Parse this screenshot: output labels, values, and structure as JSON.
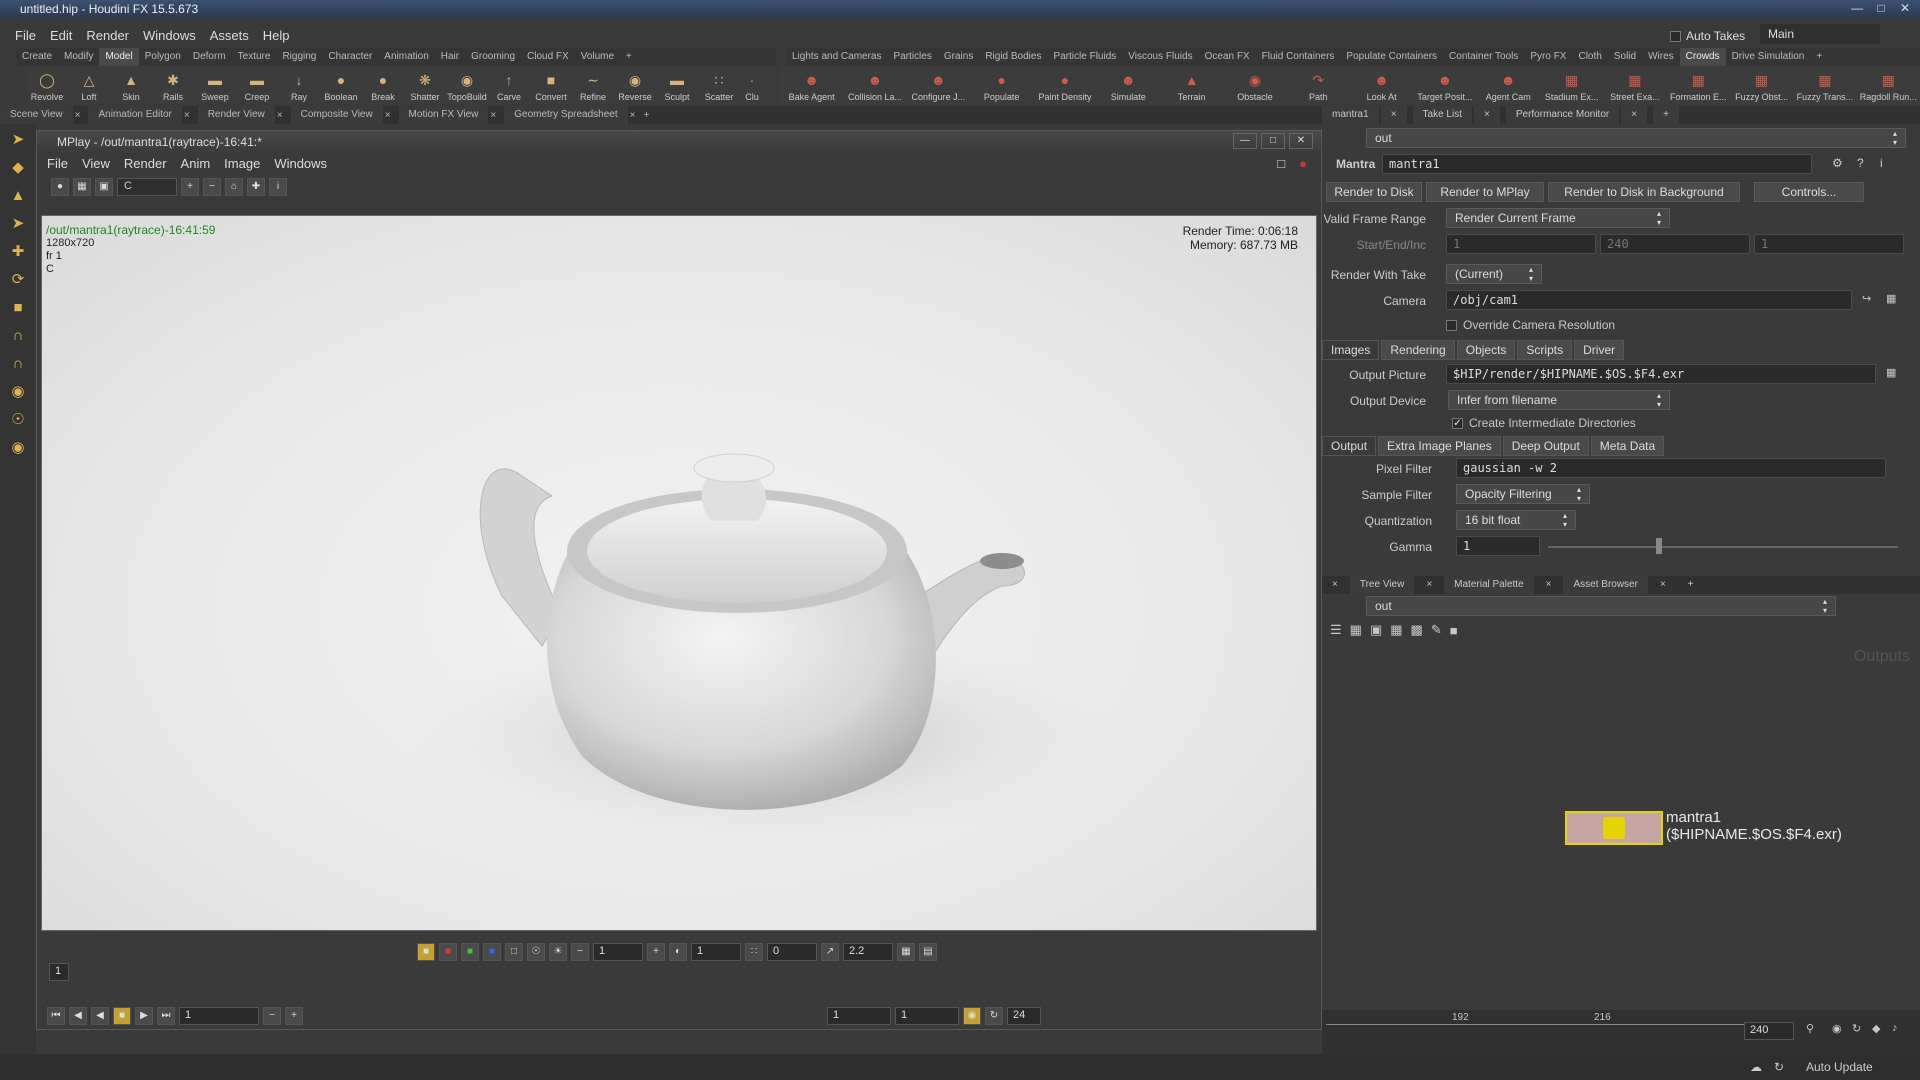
{
  "window": {
    "title": "untitled.hip - Houdini FX 15.5.673"
  },
  "menu": [
    "File",
    "Edit",
    "Render",
    "Windows",
    "Assets",
    "Help"
  ],
  "auto_takes": "Auto Takes",
  "desktop": "Main",
  "shelf_tabs_left": [
    "Create",
    "Modify",
    "Model",
    "Polygon",
    "Deform",
    "Texture",
    "Rigging",
    "Character",
    "Animation",
    "Hair",
    "Grooming",
    "Cloud FX",
    "Volume"
  ],
  "shelf_tabs_right": [
    "Lights and Cameras",
    "Particles",
    "Grains",
    "Rigid Bodies",
    "Particle Fluids",
    "Viscous Fluids",
    "Ocean FX",
    "Fluid Containers",
    "Populate Containers",
    "Container Tools",
    "Pyro FX",
    "Cloth",
    "Solid",
    "Wires",
    "Crowds",
    "Drive Simulation"
  ],
  "tools_left": [
    "Revolve",
    "Loft",
    "Skin",
    "Rails",
    "Sweep",
    "Creep",
    "Ray",
    "Boolean",
    "Break",
    "Shatter",
    "TopoBuild",
    "Carve",
    "Convert",
    "Refine",
    "Reverse",
    "Sculpt",
    "Scatter",
    "Clu"
  ],
  "tools_right": [
    "Bake Agent",
    "Collision La...",
    "Configure J...",
    "Populate",
    "Paint Density",
    "Simulate",
    "Terrain",
    "Obstacle",
    "Path",
    "Look At",
    "Target Posit...",
    "Agent Cam",
    "Stadium Ex...",
    "Street Exa...",
    "Formation E...",
    "Fuzzy Obst...",
    "Fuzzy Trans...",
    "Ragdoll Run..."
  ],
  "pane_tabs": [
    "Scene View",
    "Animation Editor",
    "Render View",
    "Composite View",
    "Motion FX View",
    "Geometry Spreadsheet"
  ],
  "mplay": {
    "title": "MPlay - /out/mantra1(raytrace)-16:41:*",
    "menu": [
      "File",
      "View",
      "Render",
      "Anim",
      "Image",
      "Windows"
    ],
    "channel": "C",
    "overlay": {
      "path": "/out/mantra1(raytrace)-16:41:59",
      "res": "1280x720",
      "frame": "fr 1",
      "channel": "C"
    },
    "render_time": "Render Time: 0:06:18",
    "memory": "Memory:   687.73 MB",
    "exposure": "1",
    "gamma_disp": "1",
    "offset": "0",
    "lut_gamma": "2.2",
    "frame_badge": "1",
    "frame_field": "1",
    "range_start": "1",
    "range_end": "1",
    "fps": "24"
  },
  "right_tabs": [
    "mantra1",
    "Take List",
    "Performance Monitor"
  ],
  "path_top": "out",
  "node_type": "Mantra",
  "node_name": "mantra1",
  "buttons": [
    "Render to Disk",
    "Render to MPlay",
    "Render to Disk in Background",
    "Controls..."
  ],
  "params": {
    "valid_frame_range": {
      "label": "Valid Frame Range",
      "value": "Render Current Frame"
    },
    "start_end_inc": {
      "label": "Start/End/Inc",
      "v1": "1",
      "v2": "240",
      "v3": "1"
    },
    "render_with_take": {
      "label": "Render With Take",
      "value": "(Current)"
    },
    "camera": {
      "label": "Camera",
      "value": "/obj/cam1"
    },
    "override": "Override Camera Resolution",
    "tabs1": [
      "Images",
      "Rendering",
      "Objects",
      "Scripts",
      "Driver"
    ],
    "output_picture": {
      "label": "Output Picture",
      "value": "$HIP/render/$HIPNAME.$OS.$F4.exr"
    },
    "output_device": {
      "label": "Output Device",
      "value": "Infer from filename"
    },
    "create_dirs": "Create Intermediate Directories",
    "tabs2": [
      "Output",
      "Extra Image Planes",
      "Deep Output",
      "Meta Data"
    ],
    "pixel_filter": {
      "label": "Pixel Filter",
      "value": "gaussian -w 2"
    },
    "sample_filter": {
      "label": "Sample Filter",
      "value": "Opacity Filtering"
    },
    "quantization": {
      "label": "Quantization",
      "value": "16 bit float"
    },
    "gamma": {
      "label": "Gamma",
      "value": "1"
    }
  },
  "net_tabs": [
    "Tree View",
    "Material Palette",
    "Asset Browser"
  ],
  "path_bottom": "out",
  "net_watermark": "Outputs",
  "node_label": "mantra1",
  "node_sub": "($HIPNAME.$OS.$F4.exr)",
  "timeline": {
    "ticks": [
      "192",
      "216"
    ],
    "end": "240"
  },
  "auto_update": "Auto Update"
}
